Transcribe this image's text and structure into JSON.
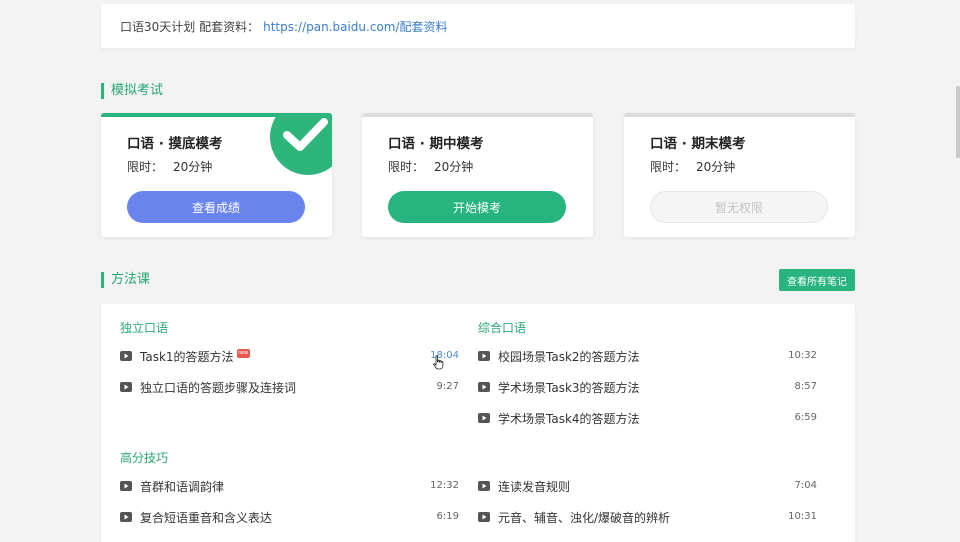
{
  "top_bar": {
    "label": "口语30天计划 配套资料：",
    "link": "https://pan.baidu.com/配套资料"
  },
  "exam_section": {
    "title": "模拟考试"
  },
  "exams": [
    {
      "title": "口语 · 摸底模考",
      "time_label": "限时：",
      "time_value": "20分钟",
      "button": "查看成绩",
      "completed": true,
      "button_color": "#6a84ee",
      "top_color": "#27b47e"
    },
    {
      "title": "口语 · 期中模考",
      "time_label": "限时：",
      "time_value": "20分钟",
      "button": "开始模考",
      "completed": false,
      "button_color": "#27b47e",
      "top_color": "#dcdcdc"
    },
    {
      "title": "口语 · 期末模考",
      "time_label": "限时：",
      "time_value": "20分钟",
      "button": "暂无权限",
      "completed": false,
      "button_color": "#f5f5f5",
      "top_color": "#dcdcdc"
    }
  ],
  "method_section": {
    "title": "方法课",
    "notes_button": "查看所有笔记"
  },
  "groups": {
    "independent": {
      "title": "独立口语",
      "lessons": [
        {
          "title": "Task1的答题方法",
          "duration": "18:04",
          "is_new": true,
          "new_label": "new"
        },
        {
          "title": "独立口语的答题步骤及连接词",
          "duration": "9:27"
        }
      ]
    },
    "integrated": {
      "title": "综合口语",
      "lessons": [
        {
          "title": "校园场景Task2的答题方法",
          "duration": "10:32"
        },
        {
          "title": "学术场景Task3的答题方法",
          "duration": "8:57"
        },
        {
          "title": "学术场景Task4的答题方法",
          "duration": "6:59"
        }
      ]
    },
    "advanced": {
      "title": "高分技巧",
      "lessons_left": [
        {
          "title": "音群和语调韵律",
          "duration": "12:32"
        },
        {
          "title": "复合短语重音和含义表达",
          "duration": "6:19"
        }
      ],
      "lessons_right": [
        {
          "title": "连读发音规则",
          "duration": "7:04"
        },
        {
          "title": "元音、辅音、浊化/爆破音的辨析",
          "duration": "10:31"
        }
      ]
    }
  },
  "colors": {
    "accent": "#27b47e",
    "link": "#3a7ed0",
    "completed_button": "#6a84ee"
  }
}
